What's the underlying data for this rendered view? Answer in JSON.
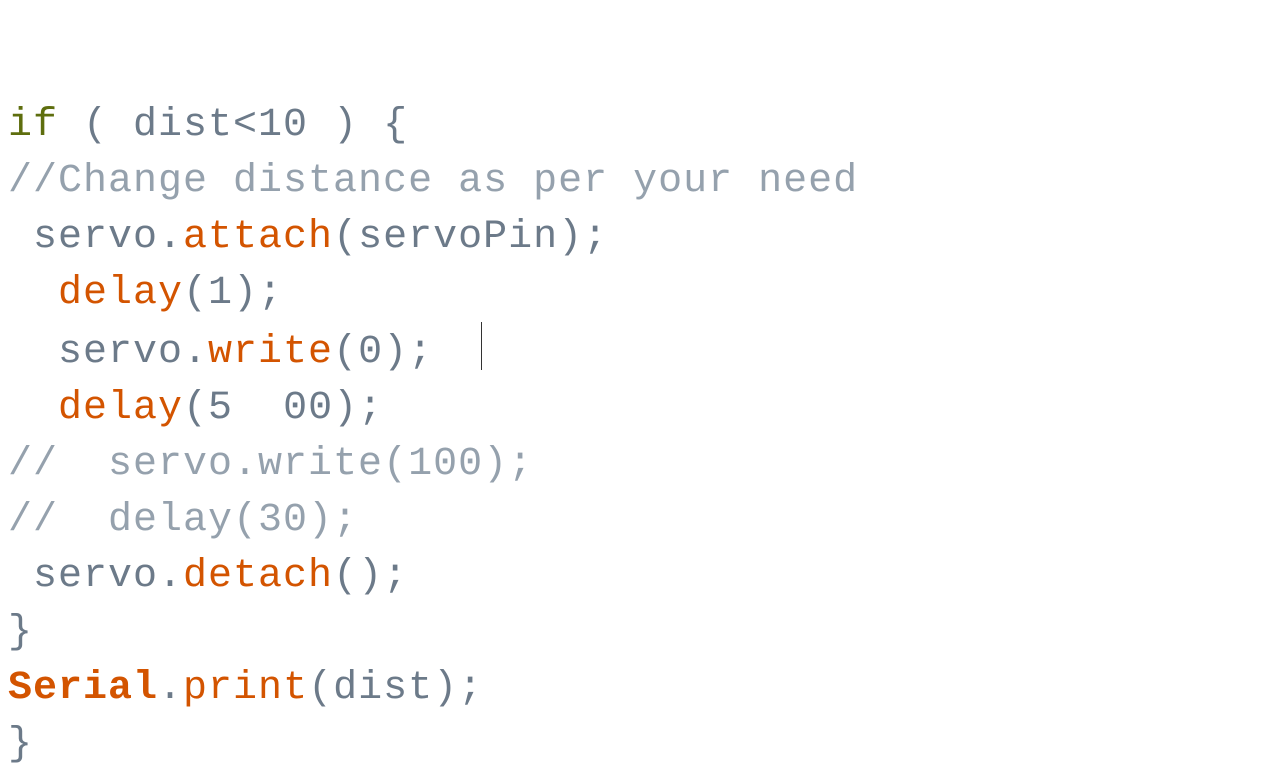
{
  "code": {
    "l1_if": "if",
    "l1_rest": " ( dist<10 ) {",
    "l2_comment": "//Change distance as per your need",
    "l3_pre": " servo.",
    "l3_fn": "attach",
    "l3_post": "(servoPin);",
    "l4_indent": "  ",
    "l4_fn": "delay",
    "l4_post": "(1);",
    "l5_indent": "  servo.",
    "l5_fn": "write",
    "l5_post": "(0);",
    "l6_indent": "  ",
    "l6_fn": "delay",
    "l6_post": "(5  00);",
    "l7_comment": "//  servo.write(100);",
    "l8_comment": "//  delay(30);",
    "l9_pre": " servo.",
    "l9_fn": "detach",
    "l9_post": "();",
    "l10_brace": "}",
    "l11_obj": "Serial",
    "l11_dot": ".",
    "l11_fn": "print",
    "l11_post": "(dist);",
    "l12_brace": "}"
  }
}
